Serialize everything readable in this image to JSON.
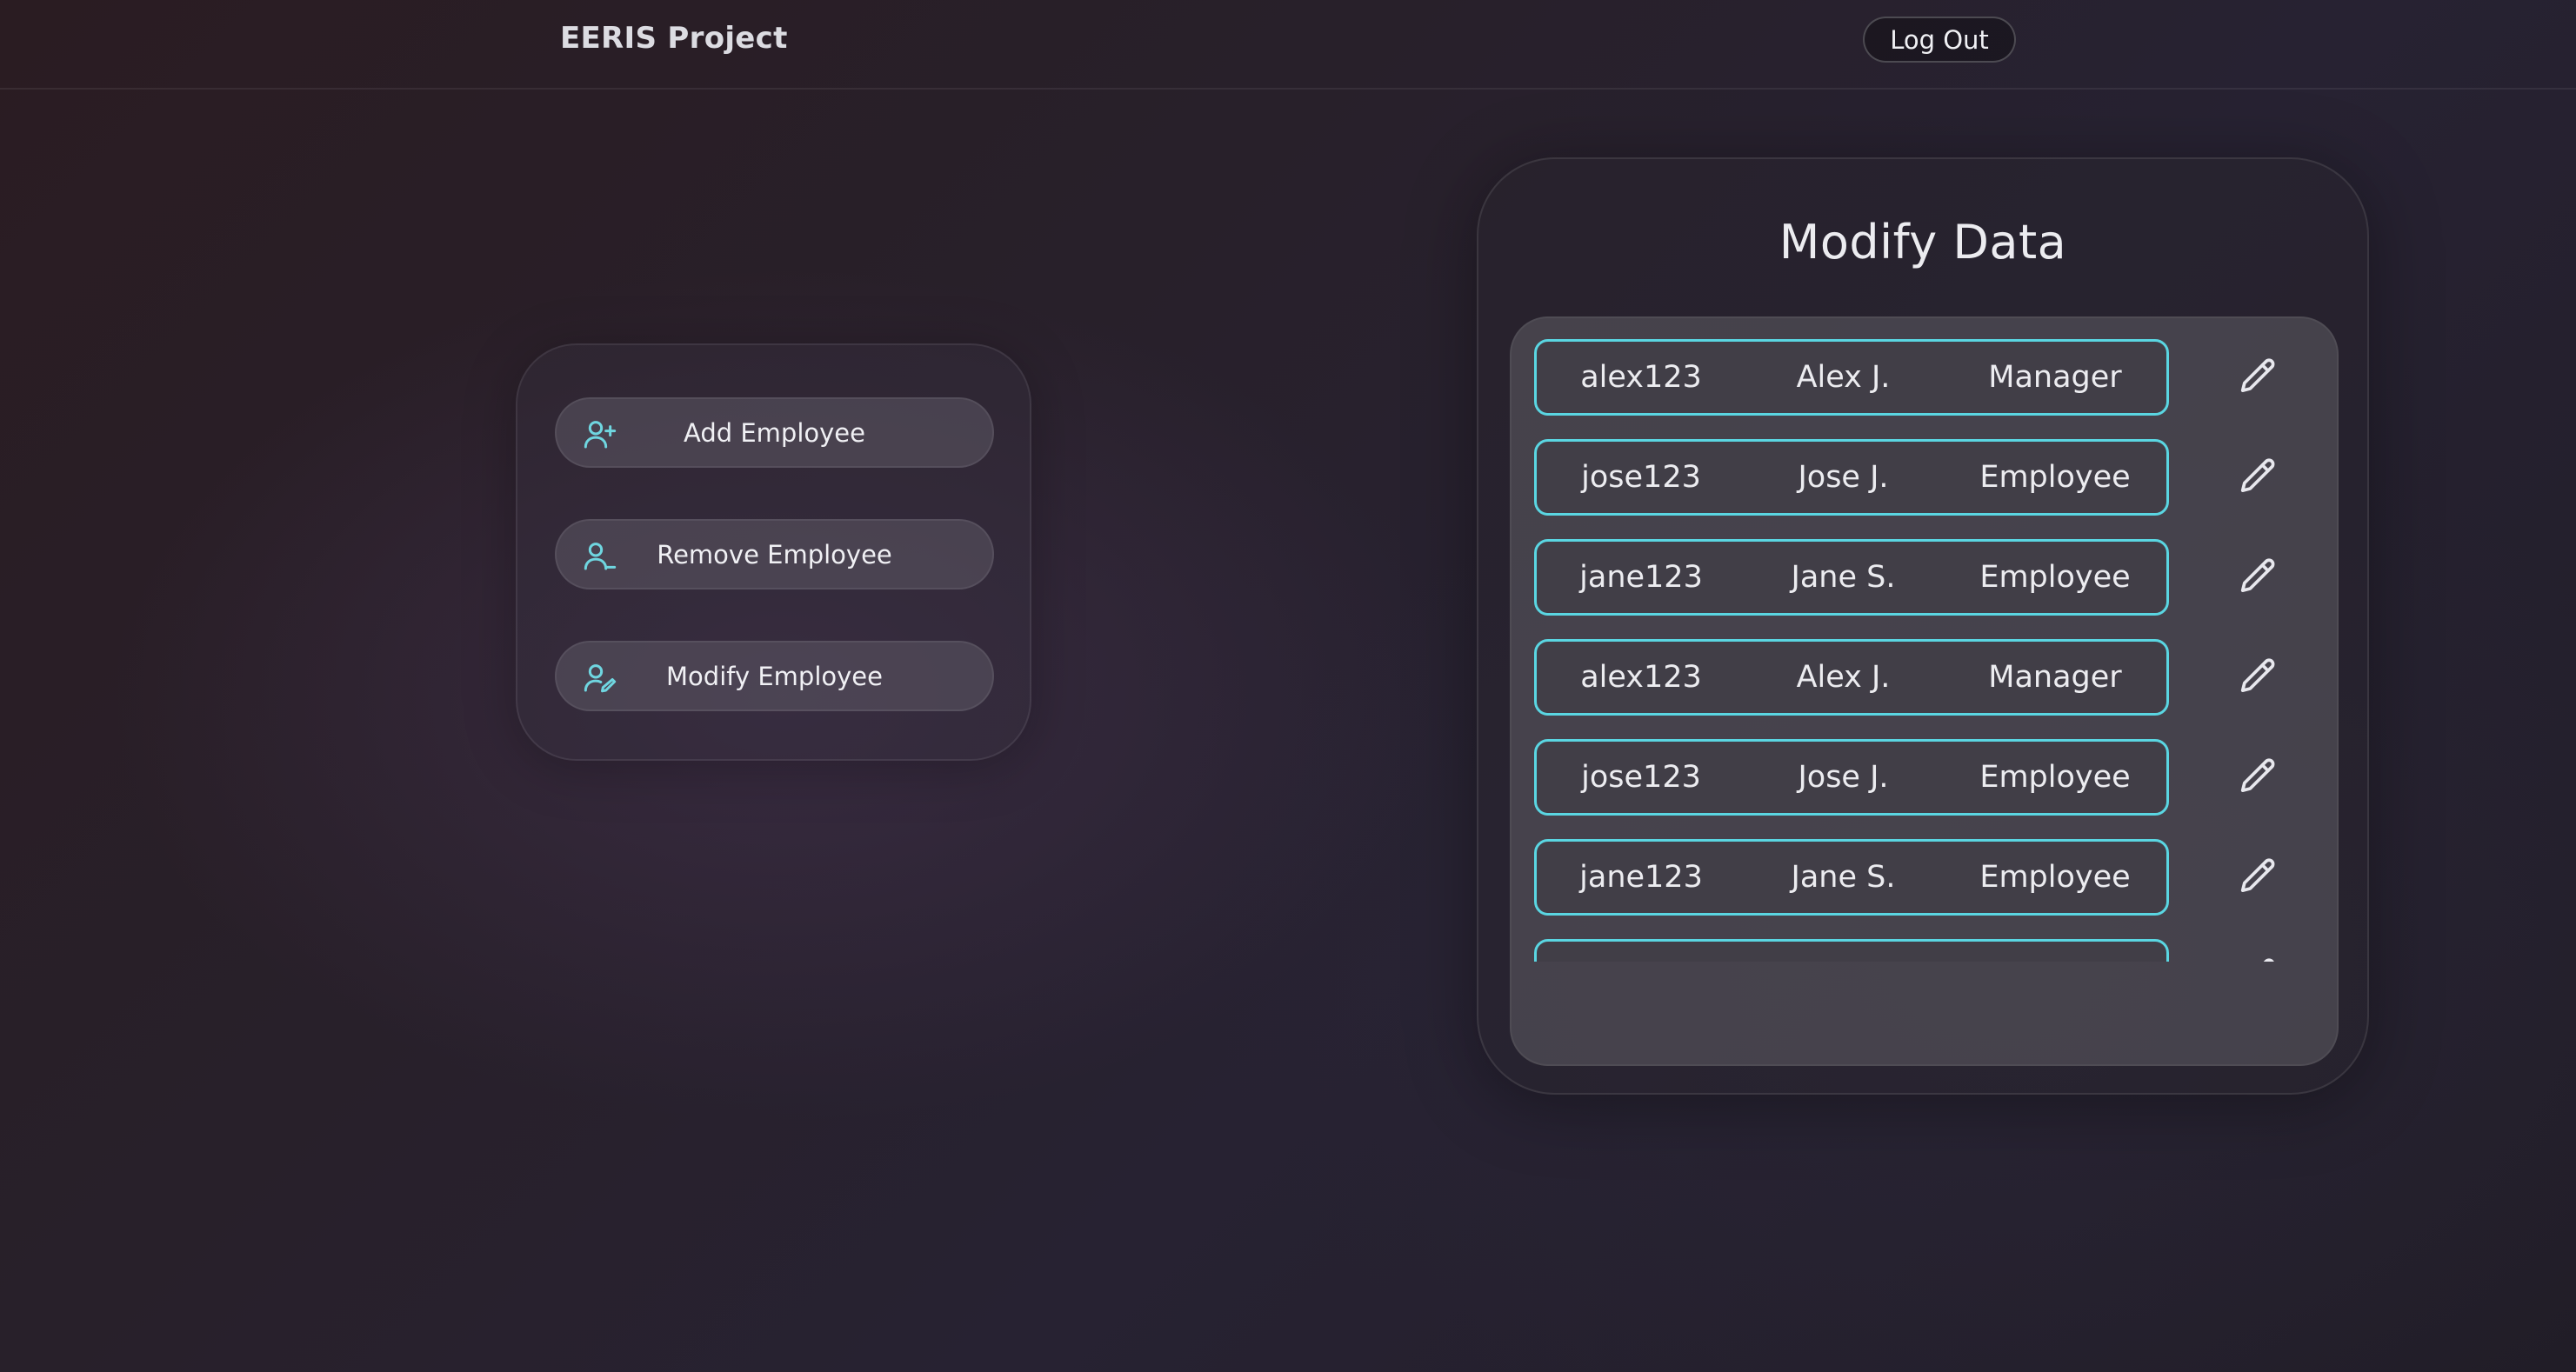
{
  "header": {
    "brand": "EERIS Project",
    "logout_label": "Log Out"
  },
  "actions": {
    "add_label": "Add Employee",
    "remove_label": "Remove Employee",
    "modify_label": "Modify Employee",
    "icon_color": "#6fd6e0"
  },
  "modify_data": {
    "title": "Modify Data",
    "accent": "#5ad6e2",
    "rows": [
      {
        "username": "alex123",
        "name": "Alex J.",
        "role": "Manager"
      },
      {
        "username": "jose123",
        "name": "Jose J.",
        "role": "Employee"
      },
      {
        "username": "jane123",
        "name": "Jane S.",
        "role": "Employee"
      },
      {
        "username": "alex123",
        "name": "Alex J.",
        "role": "Manager"
      },
      {
        "username": "jose123",
        "name": "Jose J.",
        "role": "Employee"
      },
      {
        "username": "jane123",
        "name": "Jane S.",
        "role": "Employee"
      },
      {
        "username": "",
        "name": "",
        "role": ""
      }
    ],
    "row_icon": "pencil-icon"
  }
}
